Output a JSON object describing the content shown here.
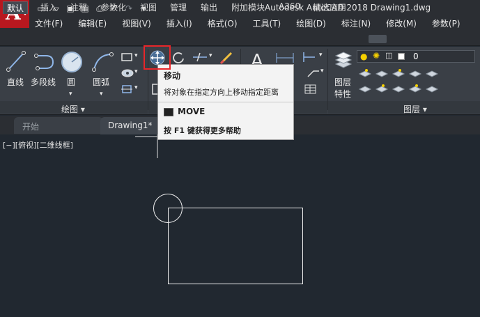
{
  "app": {
    "logo_letter": "A",
    "window_title": "Autodesk AutoCAD 2018    Drawing1.dwg"
  },
  "quick_access": [
    "new-file-icon",
    "open-folder-icon",
    "save-icon",
    "save-as-icon",
    "print-icon",
    "undo-icon",
    "redo-icon",
    "customize-icon"
  ],
  "menu": [
    "文件(F)",
    "编辑(E)",
    "视图(V)",
    "插入(I)",
    "格式(O)",
    "工具(T)",
    "绘图(D)",
    "标注(N)",
    "修改(M)",
    "参数(P)"
  ],
  "ribbon_tabs": [
    "默认",
    "插入",
    "注释",
    "参数化",
    "视图",
    "管理",
    "输出",
    "附加模块",
    "A360",
    "精选应用"
  ],
  "active_tab": "默认",
  "draw_panel": {
    "tools": [
      "直线",
      "多段线",
      "圆",
      "圆弧"
    ],
    "title": "绘图 ▾"
  },
  "layers_panel": {
    "button_label_1": "图层",
    "button_label_2": "特性",
    "current_layer": "0",
    "title": "图层 ▾"
  },
  "modify_panel_highlight": "move-button",
  "tooltip": {
    "title": "移动",
    "description": "将对象在指定方向上移动指定距离",
    "command": "MOVE",
    "help": "按 F1 键获得更多帮助"
  },
  "doc_tabs": {
    "start": "开始",
    "drawing": "Drawing1*"
  },
  "viewport_label": "[−][俯视][二维线框]",
  "colors": {
    "canvas": "#212830",
    "ribbon": "#3a3f46",
    "app_button": "#b8181f",
    "highlight_box": "#e8262a",
    "lightbulb": "#f5d000"
  }
}
